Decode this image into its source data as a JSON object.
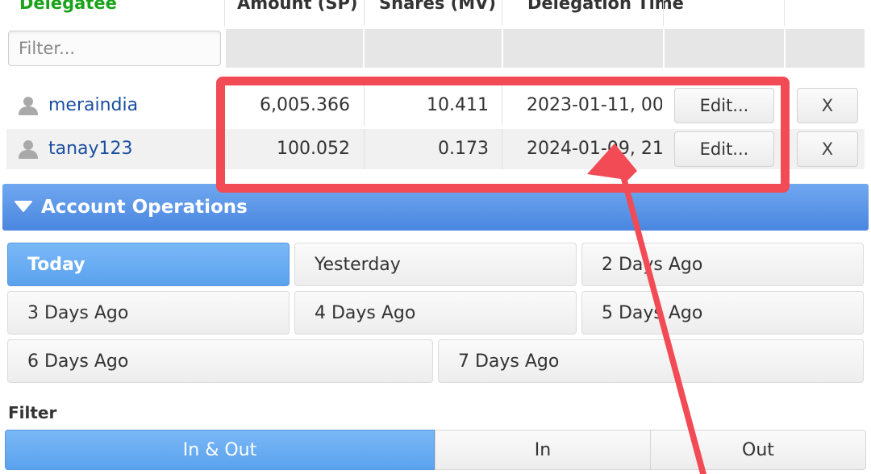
{
  "table": {
    "headers": {
      "delegatee": "Delegatee",
      "amount": "Amount (SP)",
      "shares": "Shares (MV)",
      "time": "Delegation Time"
    },
    "filter_placeholder": "Filter...",
    "rows": [
      {
        "user": "meraindia",
        "amount": "6,005.366",
        "shares": "10.411",
        "time": "2023-01-11, 00:",
        "edit_label": "Edit...",
        "remove_label": "X"
      },
      {
        "user": "tanay123",
        "amount": "100.052",
        "shares": "0.173",
        "time": "2024-01-09, 21:",
        "edit_label": "Edit...",
        "remove_label": "X"
      }
    ]
  },
  "account_operations": {
    "title": "Account Operations",
    "day_buttons": [
      "Today",
      "Yesterday",
      "2 Days Ago",
      "3 Days Ago",
      "4 Days Ago",
      "5 Days Ago",
      "6 Days Ago",
      "7 Days Ago"
    ],
    "active_day": "Today",
    "filter_label": "Filter",
    "filter_options": [
      "In & Out",
      "In",
      "Out"
    ],
    "active_filter": "In & Out"
  },
  "colors": {
    "header_green": "#1aa31a",
    "link_blue": "#1a4fa0",
    "accent_blue": "#5aa2ee",
    "annotation_red": "#f24b55"
  }
}
